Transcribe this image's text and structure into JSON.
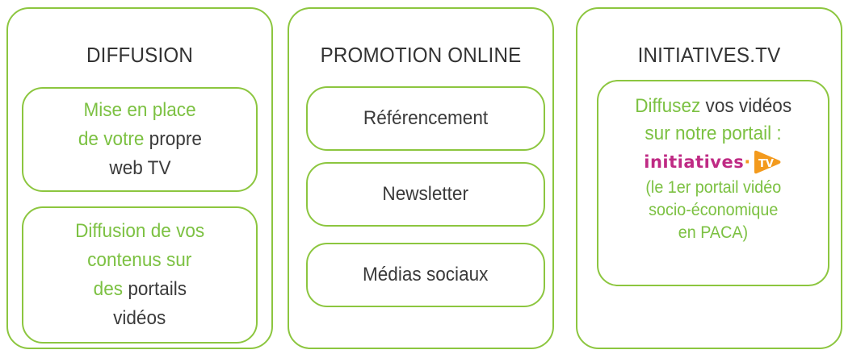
{
  "columns": [
    {
      "title": "DIFFUSION",
      "boxes": [
        {
          "lines": [
            [
              {
                "text": "Mise en place",
                "style": "green"
              }
            ],
            [
              {
                "text": "de votre",
                "style": "green"
              },
              {
                "text": " propre",
                "style": "dark"
              }
            ],
            [
              {
                "text": "web TV",
                "style": "dark"
              }
            ]
          ]
        },
        {
          "lines": [
            [
              {
                "text": "Diffusion de vos",
                "style": "green"
              }
            ],
            [
              {
                "text": "contenus sur",
                "style": "green"
              }
            ],
            [
              {
                "text": "des",
                "style": "green"
              },
              {
                "text": " portails",
                "style": "dark"
              }
            ],
            [
              {
                "text": "vidéos",
                "style": "dark"
              }
            ]
          ]
        }
      ]
    },
    {
      "title": "PROMOTION ONLINE",
      "boxes": [
        {
          "label": "Référencement"
        },
        {
          "label": "Newsletter"
        },
        {
          "label": "Médias sociaux"
        }
      ]
    },
    {
      "title": "INITIATIVES.TV",
      "box": {
        "line1": [
          {
            "text": "Diffusez",
            "style": "green"
          },
          {
            "text": " vos vidéos",
            "style": "dark"
          }
        ],
        "line2": "sur notre portail :",
        "logo": {
          "name": "initiatives-tv-logo",
          "text_main": "initiatives",
          "text_sep": "·",
          "text_tv": "TV",
          "color_main": "#bf2a84",
          "color_accent": "#f39a1d"
        },
        "small_lines": [
          "(le 1er portail vidéo",
          "socio-économique",
          "en PACA)"
        ]
      }
    }
  ],
  "colors": {
    "accent": "#8cc63f",
    "text_green": "#7cc142",
    "text_dark": "#3a3a3a"
  }
}
